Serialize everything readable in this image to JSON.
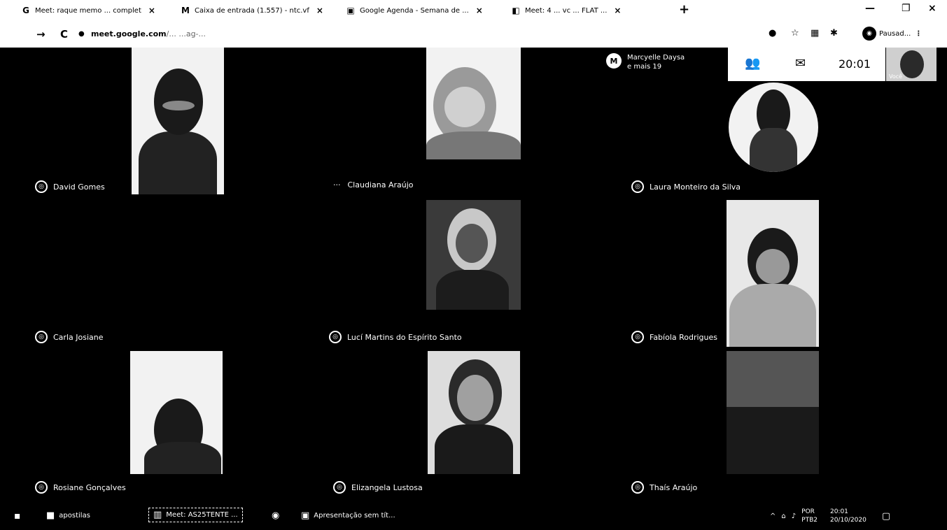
{
  "browser": {
    "tabs": [
      {
        "icon": "G",
        "title": "Meet: raque memo ... complet",
        "close": "×"
      },
      {
        "icon": "M",
        "title": "Caixa de entrada (1.557) - ntc.vf",
        "close": "×"
      },
      {
        "icon": "▣",
        "title": "Google Agenda - Semana de ...",
        "close": "×"
      },
      {
        "icon": "◧",
        "title": "Meet: 4 ... vc ... FLAT ...",
        "close": "×"
      }
    ],
    "new_tab": "+",
    "window_controls": {
      "minimize": "—",
      "maximize": "❐",
      "close": "×"
    },
    "nav": {
      "back": "→",
      "reload": "C"
    },
    "url": {
      "host": "meet.google.com",
      "path": "/... ...ag-...  "
    },
    "profile_label": "Pausad..."
  },
  "meet": {
    "header": {
      "organizer": "Marcyelle Daysa",
      "others": "e mais 19",
      "badge": "M"
    },
    "panel": {
      "people_icon": "people-icon",
      "chat_icon": "chat-icon",
      "time": "20:01"
    },
    "self_label": "Você",
    "participants": [
      {
        "name": "David Gomes"
      },
      {
        "name": "Claudiana Araújo"
      },
      {
        "name": "Laura Monteiro da Silva"
      },
      {
        "name": "Carla Josiane"
      },
      {
        "name": "Lucí Martins do Espírito Santo"
      },
      {
        "name": "Fabíola Rodrigues"
      },
      {
        "name": "Rosiane Gonçalves"
      },
      {
        "name": "Elizangela Lustosa"
      },
      {
        "name": "Thaís Araújo"
      }
    ]
  },
  "taskbar": {
    "items": [
      {
        "icon": "■",
        "label": "apostilas"
      },
      {
        "icon": "▥",
        "label": "Meet: AS25TENTE ..."
      },
      {
        "icon": "◉",
        "label": ""
      },
      {
        "icon": "▣",
        "label": "Apresentação sem tít..."
      }
    ],
    "tray": {
      "lang": "POR",
      "lang2": "PTB2",
      "time": "20:01",
      "date": "20/10/2020"
    }
  }
}
